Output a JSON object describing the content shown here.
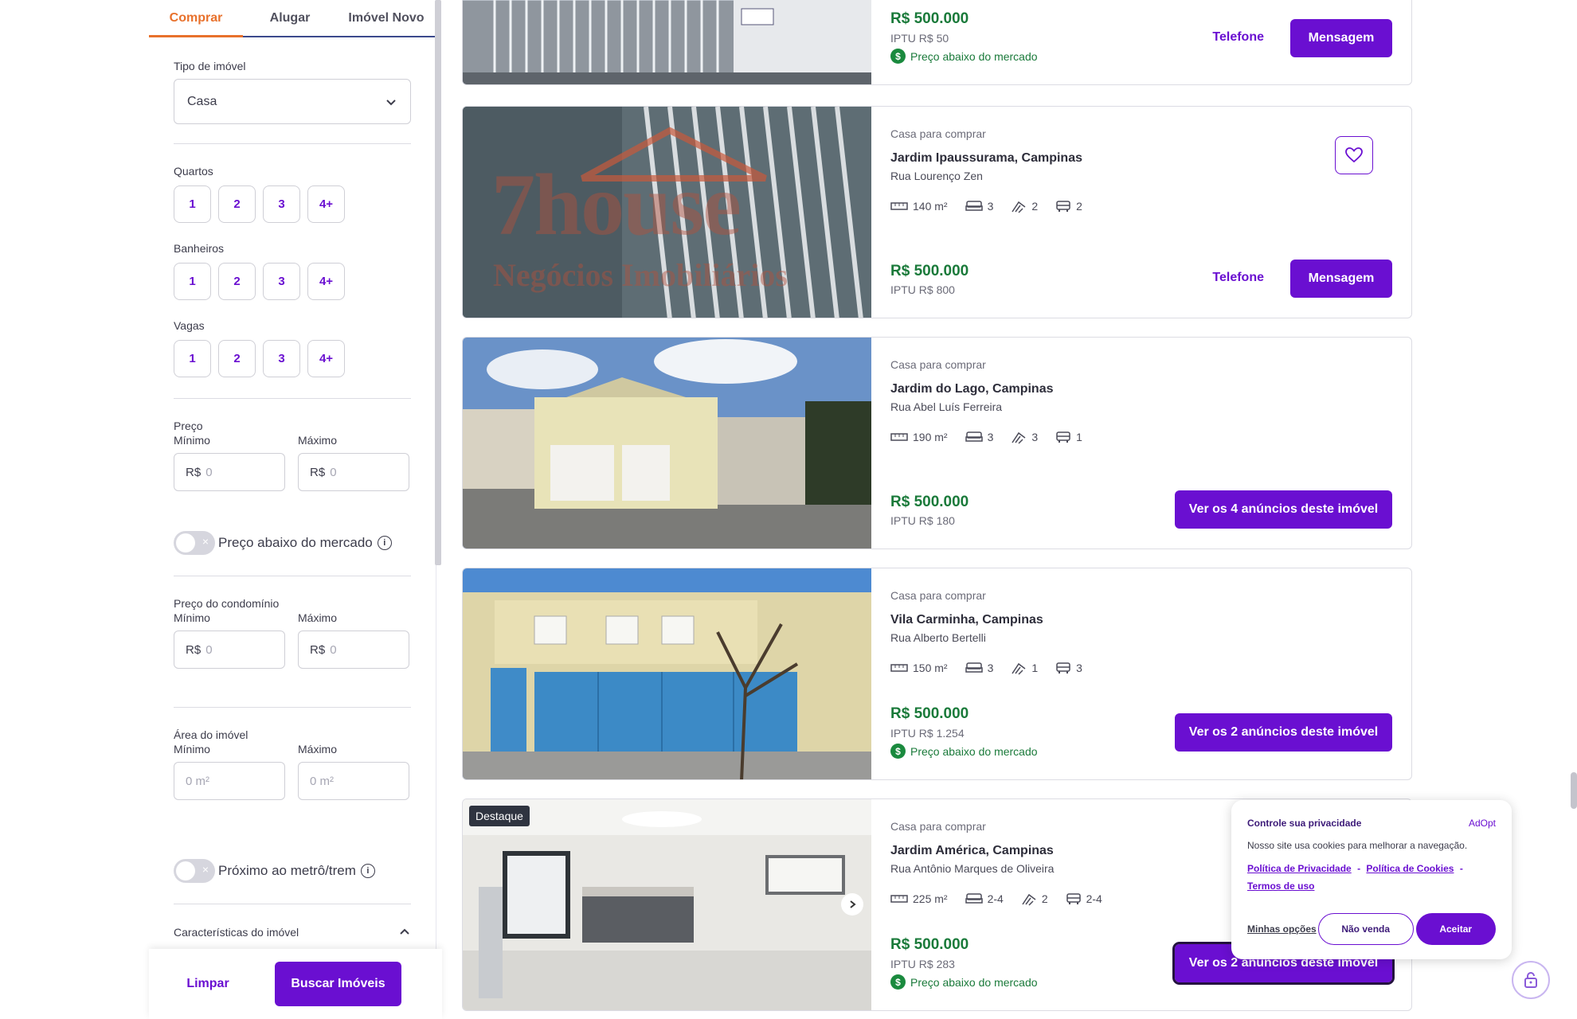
{
  "sidebar": {
    "tabs": [
      "Comprar",
      "Alugar",
      "Imóvel Novo"
    ],
    "tipo_label": "Tipo de imóvel",
    "tipo_value": "Casa",
    "quartos_label": "Quartos",
    "banheiros_label": "Banheiros",
    "vagas_label": "Vagas",
    "pill_options": [
      "1",
      "2",
      "3",
      "4+"
    ],
    "preco_label": "Preço",
    "minimo": "Mínimo",
    "maximo": "Máximo",
    "currency": "R$",
    "zero": "0",
    "area_placeholder": "0 m²",
    "preco_abaixo": "Preço abaixo do mercado",
    "condominio_label": "Preço do condomínio",
    "area_label": "Área do imóvel",
    "metro_label": "Próximo ao metrô/trem",
    "caracteristicas_label": "Características do imóvel",
    "info": "i",
    "limpar": "Limpar",
    "buscar": "Buscar Imóveis"
  },
  "listings": [
    {
      "price": "R$ 500.000",
      "iptu": "IPTU R$ 50",
      "below_market": "Preço abaixo do mercado",
      "phone": "Telefone",
      "message": "Mensagem"
    },
    {
      "type": "Casa para comprar",
      "title": "Jardim Ipaussurama, Campinas",
      "address": "Rua Lourenço Zen",
      "area": "140 m²",
      "bedrooms": "3",
      "bathrooms": "2",
      "parking": "2",
      "price": "R$ 500.000",
      "iptu": "IPTU R$ 800",
      "phone": "Telefone",
      "message": "Mensagem",
      "watermark_top": "7house",
      "watermark_bottom": "Negócios Imobiliários"
    },
    {
      "type": "Casa para comprar",
      "title": "Jardim do Lago, Campinas",
      "address": "Rua Abel Luís Ferreira",
      "area": "190 m²",
      "bedrooms": "3",
      "bathrooms": "3",
      "parking": "1",
      "price": "R$ 500.000",
      "iptu": "IPTU R$ 180",
      "cta": "Ver os 4 anúncios deste imóvel"
    },
    {
      "type": "Casa para comprar",
      "title": "Vila Carminha, Campinas",
      "address": "Rua Alberto Bertelli",
      "area": "150 m²",
      "bedrooms": "3",
      "bathrooms": "1",
      "parking": "3",
      "price": "R$ 500.000",
      "iptu": "IPTU R$ 1.254",
      "below_market": "Preço abaixo do mercado",
      "cta": "Ver os 2 anúncios deste imóvel"
    },
    {
      "badge": "Destaque",
      "type": "Casa para comprar",
      "title": "Jardim América, Campinas",
      "address": "Rua Antônio Marques de Oliveira",
      "area": "225 m²",
      "bedrooms": "2-4",
      "bathrooms": "2",
      "parking": "2-4",
      "price": "R$ 500.000",
      "iptu": "IPTU R$ 283",
      "below_market": "Preço abaixo do mercado",
      "cta": "Ver os 2 anúncios deste imóvel"
    }
  ],
  "cookie": {
    "title": "Controle sua privacidade",
    "brand": "AdOpt",
    "text": "Nosso site usa cookies para melhorar a navegação.",
    "link_privacy": "Política de Privacidade",
    "link_cookies": "Política de Cookies",
    "link_terms": "Termos de uso",
    "sep": "-",
    "options": "Minhas opções",
    "nao_venda": "Não venda",
    "aceitar": "Aceitar"
  },
  "colors": {
    "brand": "#6a0fd1",
    "accent_tab": "#e8712c",
    "price_green": "#1a7a3a"
  }
}
